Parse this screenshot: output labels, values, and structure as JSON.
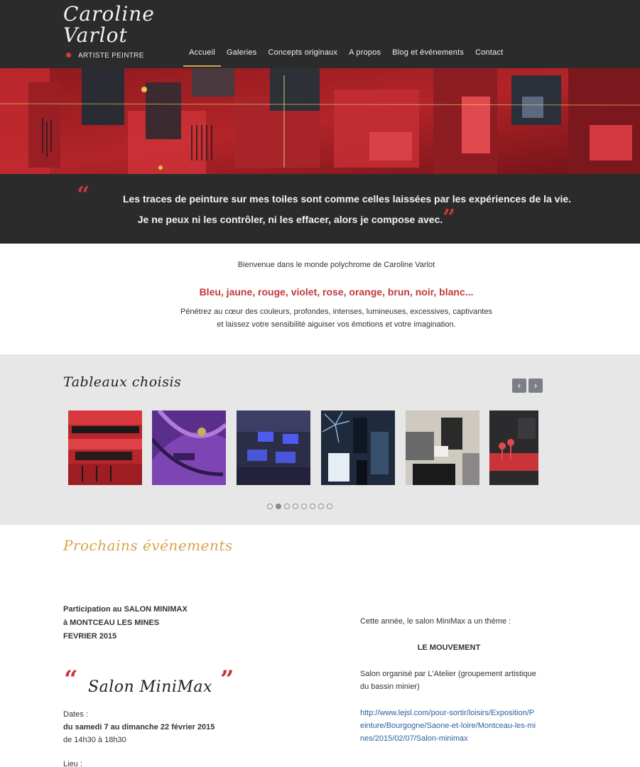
{
  "header": {
    "logo_line1": "Caroline",
    "logo_line2": "Varlot",
    "logo_subtitle": "ARTISTE PEINTRE",
    "nav": [
      {
        "label": "Accueil",
        "active": true
      },
      {
        "label": "Galeries",
        "active": false
      },
      {
        "label": "Concepts originaux",
        "active": false
      },
      {
        "label": "A propos",
        "active": false
      },
      {
        "label": "Blog et événements",
        "active": false
      },
      {
        "label": "Contact",
        "active": false
      }
    ]
  },
  "quote": {
    "line1": "Les traces de peinture sur mes toiles sont comme celles laissées par les expériences de la vie.",
    "line2": "Je ne peux ni les contrôler, ni les effacer, alors je compose avec.",
    "open_mark": "“",
    "close_mark": "”"
  },
  "intro": {
    "welcome": "Bienvenue dans le monde polychrome de Caroline Varlot",
    "colors": "Bleu, jaune, rouge, violet, rose, orange, brun, noir, blanc...",
    "text_line1": "Pénétrez au cœur des couleurs, profondes, intenses, lumineuses, excessives, captivantes",
    "text_line2": "et laissez votre sensibilité aiguiser vos émotions et votre imagination."
  },
  "featured": {
    "title": "Tableaux choisis",
    "prev_label": "‹",
    "next_label": "›",
    "dots_count": 8,
    "active_dot": 1
  },
  "events": {
    "title": "Prochains événements",
    "head_line1": "Participation au SALON MINIMAX",
    "head_line2": "à MONTCEAU LES MINES",
    "head_line3": "FEVRIER 2015",
    "salon_name": "Salon MiniMax",
    "dates_label": "Dates :",
    "dates_value": "du samedi 7 au dimanche 22 février 2015",
    "hours": "de 14h30 à 18h30",
    "lieu_label": "Lieu :",
    "theme_line": "Cette année, le salon MiniMax a un thème :",
    "theme_name": "LE MOUVEMENT",
    "organizer": "Salon organisé par L'Atelier (groupement artistique du bassin minier)",
    "link": "http://www.lejsl.com/pour-sortir/loisirs/Exposition/Peinture/Bourgogne/Saone-et-loire/Montceau-les-mines/2015/02/07/Salon-minimax"
  },
  "colors": {
    "header_bg": "#2b2b2b",
    "accent_red": "#c4393a",
    "accent_gold": "#d9a24a",
    "featured_bg": "#e7e7e7",
    "link": "#2c5fa0"
  }
}
